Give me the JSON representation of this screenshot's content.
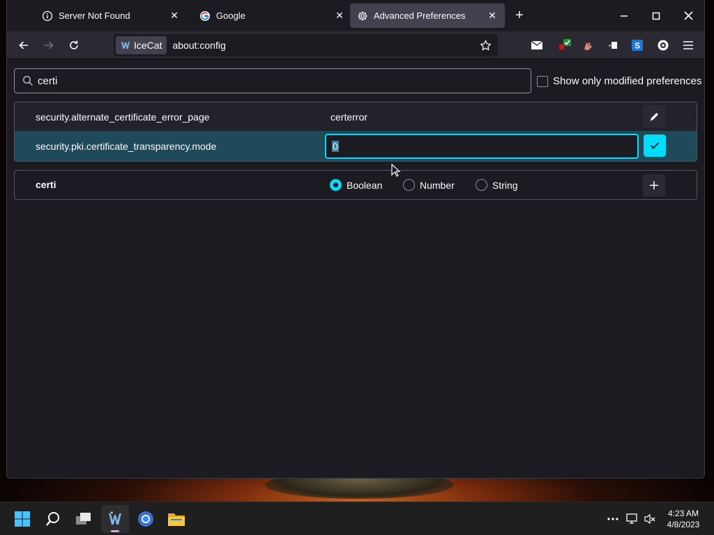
{
  "tabs": [
    {
      "label": "Server Not Found",
      "icon": "info-icon",
      "active": false
    },
    {
      "label": "Google",
      "icon": "google-icon",
      "active": false
    },
    {
      "label": "Advanced Preferences",
      "icon": "gear-icon",
      "active": true
    }
  ],
  "navbar": {
    "identity_label": "IceCat",
    "url": "about:config"
  },
  "search": {
    "value": "certi",
    "show_modified_label": "Show only modified preferences",
    "show_modified_checked": false
  },
  "prefs": [
    {
      "name": "security.alternate_certificate_error_page",
      "value": "certerror"
    },
    {
      "name": "security.pki.certificate_transparency.mode",
      "value": "0"
    }
  ],
  "add_row": {
    "name": "certi",
    "types": [
      "Boolean",
      "Number",
      "String"
    ],
    "selected_type": "Boolean"
  },
  "taskbar": {
    "time": "4:23 AM",
    "date": "4/8/2023"
  },
  "colors": {
    "accent": "#00ddff",
    "selected_row": "#1f4a5a",
    "background": "#1c1b22"
  }
}
